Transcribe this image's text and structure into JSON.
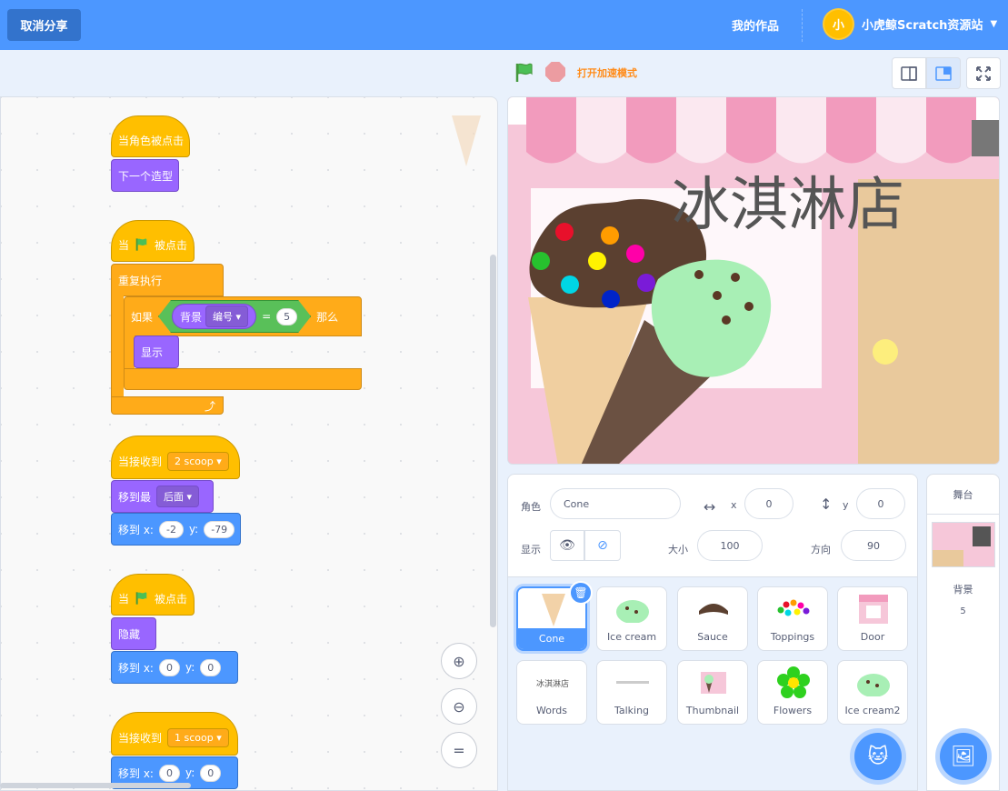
{
  "topbar": {
    "unshare": "取消分享",
    "my_works": "我的作品",
    "username": "小虎鲸Scratch资源站",
    "avatar_text": "小"
  },
  "controls": {
    "turbo": "打开加速模式"
  },
  "scripts": {
    "s1_hat": "当角色被点击",
    "s1_b1": "下一个造型",
    "s2_hat_a": "当",
    "s2_hat_b": "被点击",
    "s2_forever": "重复执行",
    "s2_if": "如果",
    "s2_backdrop": "背景",
    "s2_number": "编号",
    "s2_eq": "=",
    "s2_value": "5",
    "s2_then": "那么",
    "s2_show": "显示",
    "s3_hat": "当接收到",
    "s3_msg": "2 scoop",
    "s3_layer": "移到最",
    "s3_layer_opt": "后面",
    "s3_goto": "移到 x:",
    "s3_x": "-2",
    "s3_y_lbl": "y:",
    "s3_y": "-79",
    "s4_hat_a": "当",
    "s4_hat_b": "被点击",
    "s4_hide": "隐藏",
    "s4_goto": "移到 x:",
    "s4_x": "0",
    "s4_y_lbl": "y:",
    "s4_y": "0",
    "s5_hat": "当接收到",
    "s5_msg": "1 scoop",
    "s5_goto": "移到 x:",
    "s5_x": "0",
    "s5_y_lbl": "y:",
    "s5_y": "0"
  },
  "zoom": {
    "reset": "="
  },
  "stage": {
    "title": "冰淇淋店"
  },
  "sprite_info": {
    "sprite_lbl": "角色",
    "sprite_name": "Cone",
    "x_lbl": "x",
    "x": "0",
    "y_lbl": "y",
    "y": "0",
    "show_lbl": "显示",
    "size_lbl": "大小",
    "size": "100",
    "dir_lbl": "方向",
    "dir": "90"
  },
  "sprites": [
    {
      "name": "Cone"
    },
    {
      "name": "Ice cream"
    },
    {
      "name": "Sauce"
    },
    {
      "name": "Toppings"
    },
    {
      "name": "Door"
    },
    {
      "name": "Words"
    },
    {
      "name": "Talking"
    },
    {
      "name": "Thumbnail"
    },
    {
      "name": "Flowers"
    },
    {
      "name": "Ice cream2"
    }
  ],
  "words_thumb": "冰淇淋店",
  "stage_panel": {
    "title": "舞台",
    "backdrop_lbl": "背景",
    "backdrop_count": "5"
  },
  "colors": {
    "accent": "#4c97ff",
    "events": "#ffbf00",
    "looks": "#9966ff",
    "control": "#ffab19",
    "motion": "#4c97ff"
  }
}
